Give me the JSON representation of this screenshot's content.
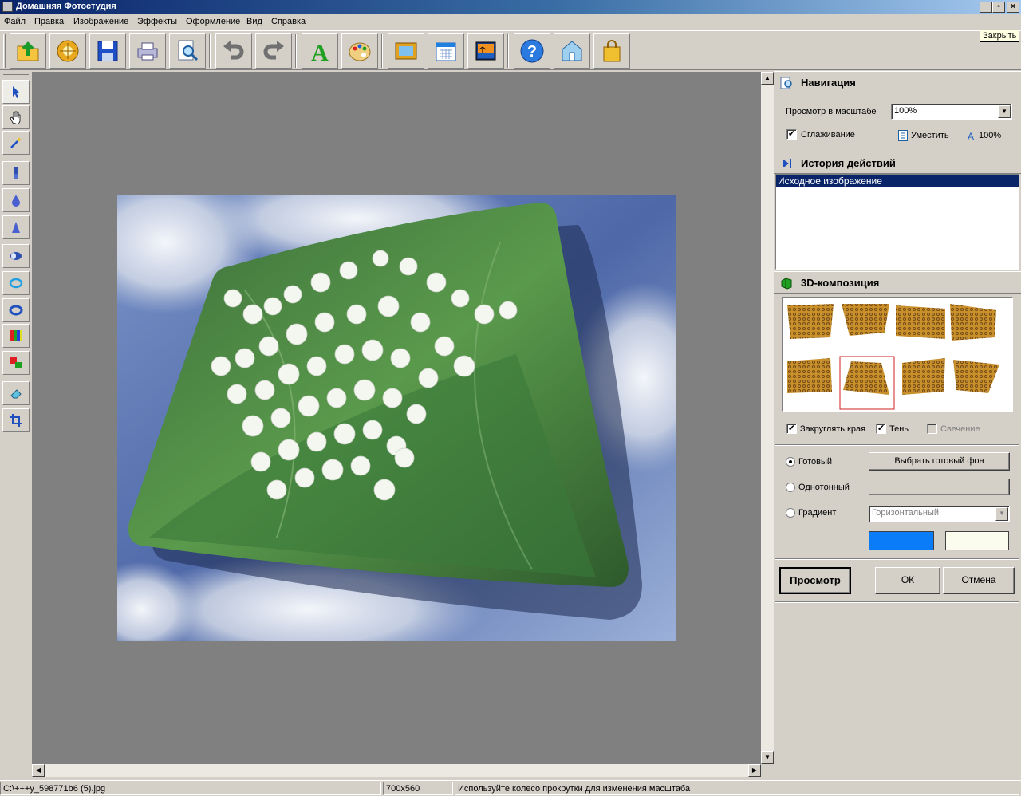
{
  "window": {
    "title": "Домашняя Фотостудия",
    "close_tooltip": "Закрыть"
  },
  "menu": [
    "Файл",
    "Правка",
    "Изображение",
    "Эффекты",
    "Оформление",
    "Вид",
    "Справка"
  ],
  "toolbar_icons": [
    "open-icon",
    "gallery-icon",
    "save-icon",
    "print-icon",
    "preview-icon",
    "undo-icon",
    "redo-icon",
    "text-icon",
    "palette-icon",
    "frame-icon",
    "calendar-icon",
    "postcard-icon",
    "help-icon",
    "home-icon",
    "shop-icon"
  ],
  "left_tools": [
    "pointer-icon",
    "hand-icon",
    "magic-wand-icon",
    "brush-icon",
    "drop-icon",
    "sharpen-icon",
    "ellipse-icon",
    "ring-icon",
    "oval-icon",
    "color-bars-icon",
    "swap-colors-icon",
    "eraser-icon",
    "crop-icon"
  ],
  "navigation": {
    "title": "Навигация",
    "zoom_label": "Просмотр в масштабе",
    "zoom_value": "100%",
    "smooth_label": "Сглаживание",
    "smooth_checked": true,
    "fit_label": "Уместить",
    "actual_label": "100%"
  },
  "history": {
    "title": "История действий",
    "items": [
      "Исходное изображение"
    ]
  },
  "composition": {
    "title": "3D-композиция",
    "selected_thumb": 6,
    "round_label": "Закруглять края",
    "round_checked": true,
    "shadow_label": "Тень",
    "shadow_checked": true,
    "glow_label": "Свечение",
    "glow_checked": false
  },
  "background": {
    "ready_label": "Готовый",
    "ready_button": "Выбрать готовый фон",
    "solid_label": "Однотонный",
    "gradient_label": "Градиент",
    "gradient_type": "Горизонтальный",
    "selected": "ready",
    "color1": "#0a7cf7",
    "color2": "#fbfbee"
  },
  "buttons": {
    "preview": "Просмотр",
    "ok": "ОК",
    "cancel": "Отмена"
  },
  "status": {
    "file": "C:\\+++у_598771b6 (5).jpg",
    "size": "700x560",
    "hint": "Используйте колесо прокрутки для изменения масштаба"
  },
  "colors": {
    "titlebar": "#0a246a",
    "canvas": "#808080",
    "history_selection": "#0a246a"
  }
}
